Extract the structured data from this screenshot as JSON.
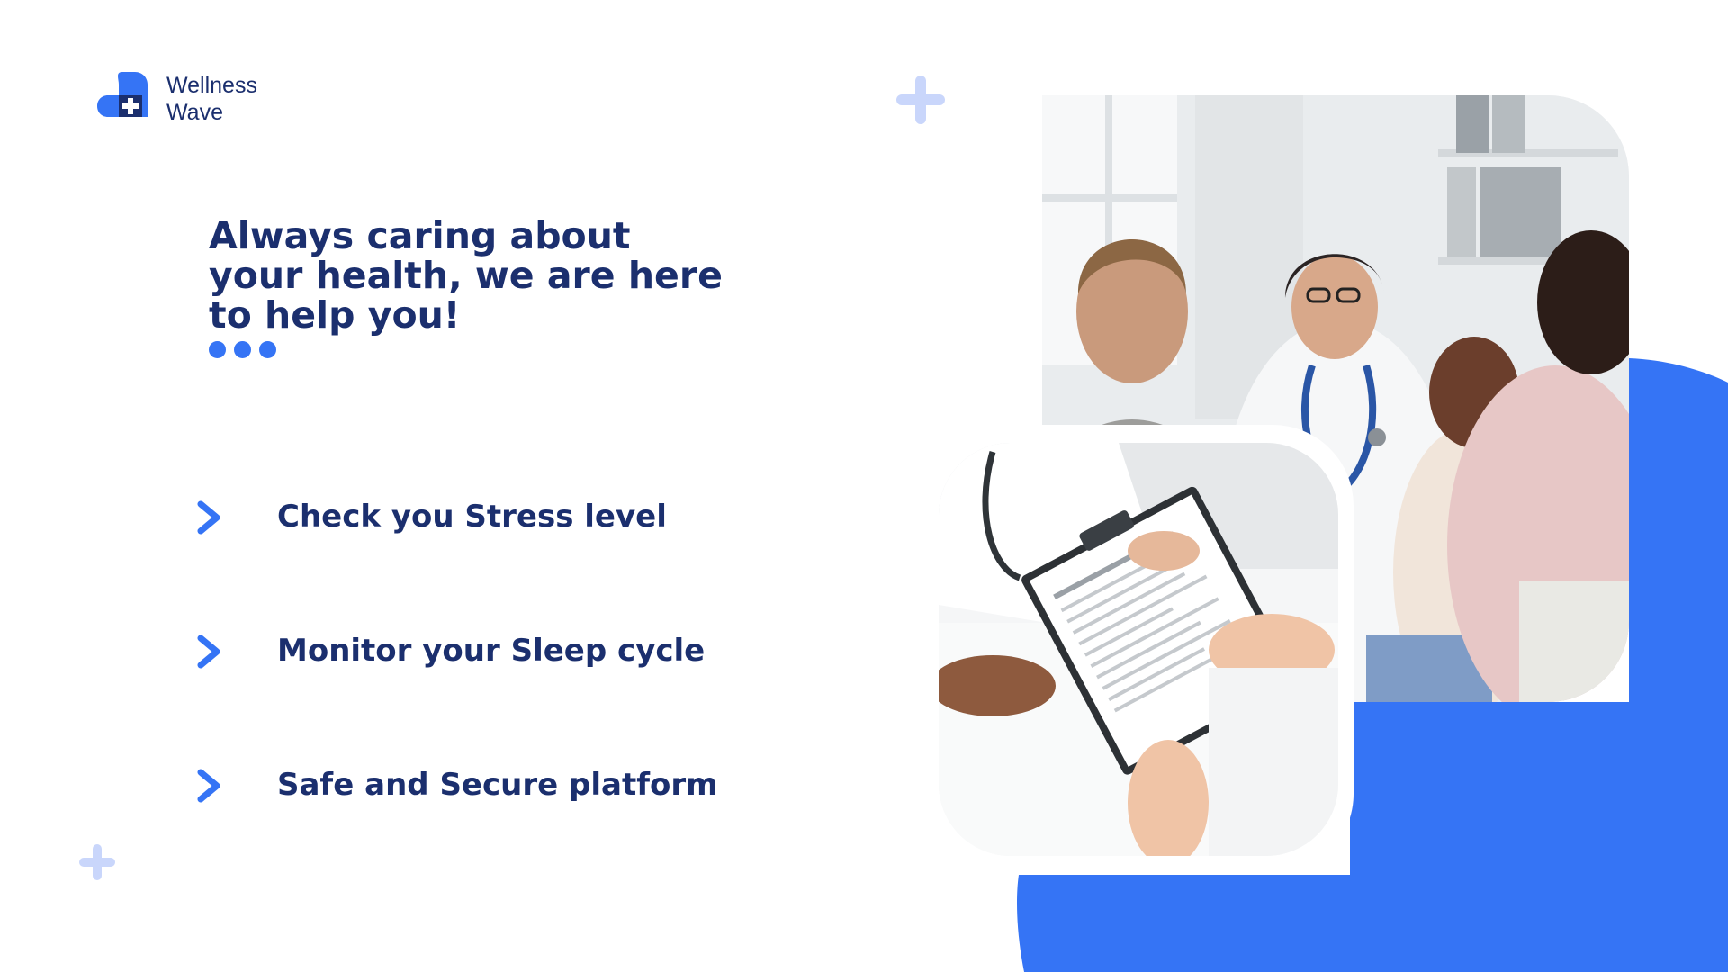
{
  "brand": {
    "name_line1": "Wellness",
    "name_line2": "Wave",
    "logo_icon": "heart-plus-icon"
  },
  "hero": {
    "headline": "Always caring about your health, we are here to help you!"
  },
  "features": [
    {
      "icon": "chevron-right-icon",
      "label": "Check you Stress level"
    },
    {
      "icon": "chevron-right-icon",
      "label": "Monitor your Sleep cycle"
    },
    {
      "icon": "chevron-right-icon",
      "label": "Safe and Secure platform"
    }
  ],
  "images": {
    "main": "doctor-consultation-photo",
    "inset": "health-check-clipboard-photo"
  },
  "colors": {
    "primary": "#3574f5",
    "navy": "#1b2f6e",
    "plus_light": "#c9d6fb",
    "background": "#ffffff"
  }
}
